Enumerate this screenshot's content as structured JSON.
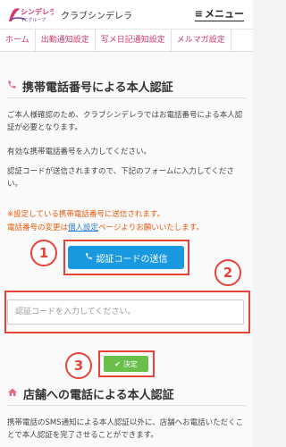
{
  "header": {
    "logo_text": "シンデレラ",
    "logo_sub": "FCグループ",
    "site_name": "クラブシンデレラ",
    "menu_label": "メニュー",
    "menu_icon": "hamburger-icon"
  },
  "nav": {
    "items": [
      {
        "label": "ホーム"
      },
      {
        "label": "出勤通知設定"
      },
      {
        "label": "写メ日記通知設定"
      },
      {
        "label": "メルマガ設定"
      }
    ]
  },
  "phone_auth": {
    "title": "携帯電話番号による本人認証",
    "icon": "phone-icon",
    "para1": "ご本人様確認のため、クラブシンデレラではお電話番号による本人認証が必要となります。",
    "para2": "有効な携帯電話番号を入力してください。",
    "para3": "認証コードが送信されますので、下記のフォームに入力してください。",
    "warn1": "※設定している携帯電話番号に送信されます。",
    "warn2_prefix": "電話番号の変更は",
    "warn2_link": "個人設定",
    "warn2_suffix": "ページよりお願いいたします。",
    "send_button": "認証コードの送信",
    "code_placeholder": "認証コードを入力してください。",
    "ok_button": "決定"
  },
  "store_auth": {
    "title": "店舗への電話による本人認証",
    "icon": "home-icon",
    "para": "携帯電話のSMS通知による本人認証以外に、店舗へお電話いただくことで本人認証を完了させることができます。"
  },
  "annotations": {
    "n1": "1",
    "n2": "2",
    "n3": "3"
  },
  "colors": {
    "accent_pink": "#d4386d",
    "send_blue": "#1a99de",
    "ok_green": "#6abf4b",
    "warn_orange": "#e85a0c",
    "annotation_red": "#e8433a"
  }
}
